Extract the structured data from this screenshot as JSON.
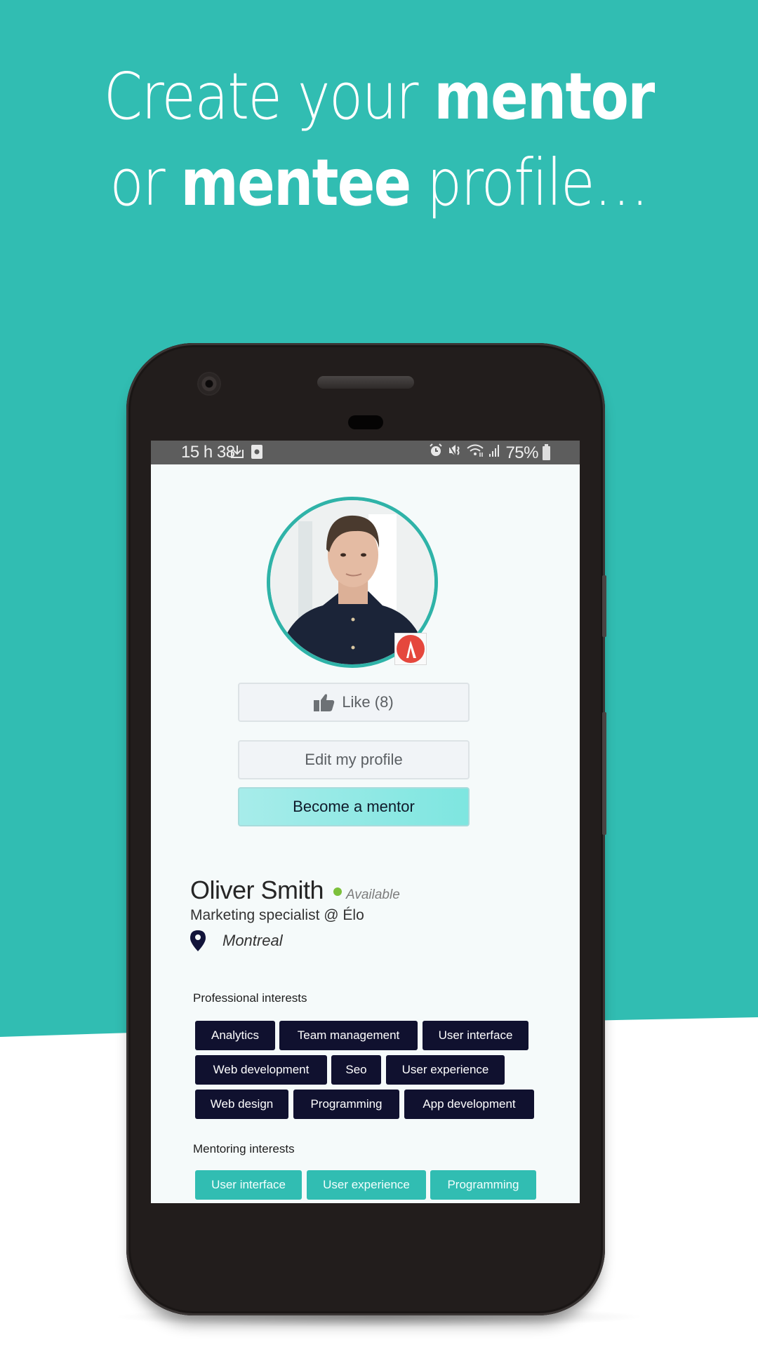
{
  "colors": {
    "brand_teal": "#31bdb2",
    "tag_dark": "#10112f",
    "mentor_button": "#7ee6e0",
    "available_dot": "#7cc03b",
    "badge_red": "#e5473d"
  },
  "headline": {
    "line1_light": "Create your ",
    "line1_bold": "mentor",
    "line2_light_start": "or ",
    "line2_bold": "mentee",
    "line2_light_end": " profile…"
  },
  "statusbar": {
    "time": "15 h 38",
    "left_icons": [
      "download-icon",
      "clock-card-icon"
    ],
    "right_icons": [
      "alarm-icon",
      "mute-icon",
      "wifi-icon",
      "signal-icon"
    ],
    "battery": "75%"
  },
  "profile": {
    "like_label": "Like (8)",
    "edit_label": "Edit my profile",
    "become_mentor_label": "Become a mentor",
    "name": "Oliver Smith",
    "status": "Available",
    "job": "Marketing specialist @ Élo",
    "location": "Montreal"
  },
  "professional_interests": {
    "title": "Professional interests",
    "tags": [
      "Analytics",
      "Team management",
      "User interface",
      "Web development",
      "Seo",
      "User experience",
      "Web design",
      "Programming",
      "App development"
    ]
  },
  "mentoring_interests": {
    "title": "Mentoring interests",
    "tags": [
      "User interface",
      "User experience",
      "Programming"
    ]
  }
}
